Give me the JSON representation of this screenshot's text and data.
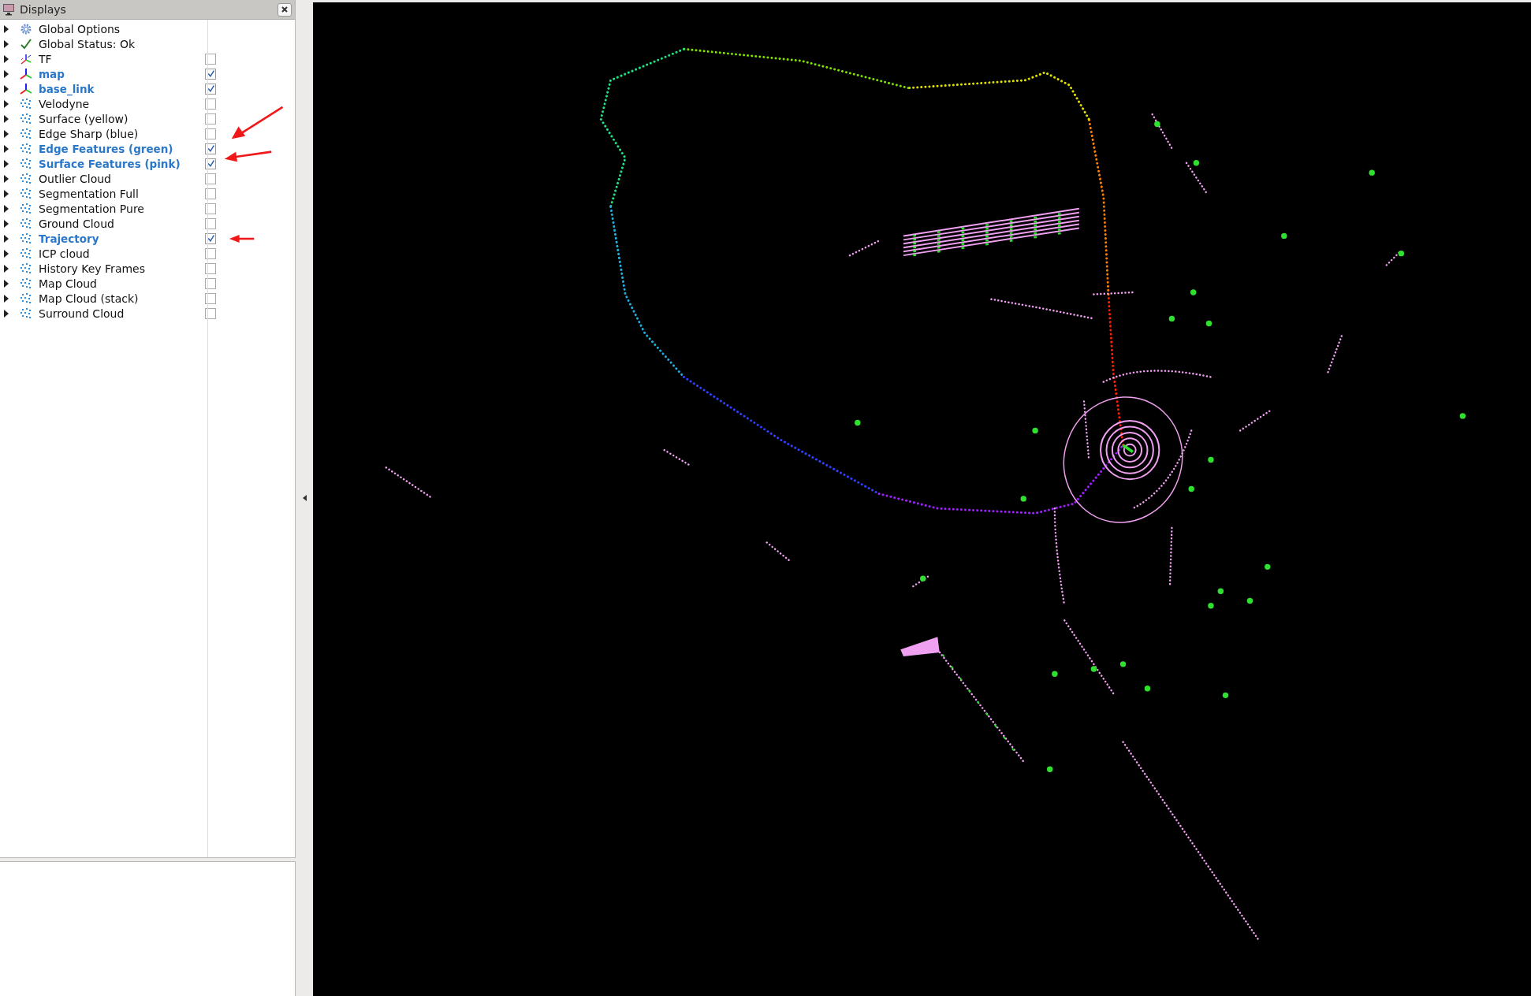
{
  "panel": {
    "title": "Displays"
  },
  "items": [
    {
      "label": "Global Options",
      "kind": "options"
    },
    {
      "label": "Global Status: Ok",
      "kind": "status"
    },
    {
      "label": "TF",
      "kind": "tf",
      "checked": false
    },
    {
      "label": "map",
      "kind": "axes",
      "checked": true
    },
    {
      "label": "base_link",
      "kind": "axes",
      "checked": true
    },
    {
      "label": "Velodyne",
      "kind": "cloud",
      "checked": false
    },
    {
      "label": "Surface (yellow)",
      "kind": "cloud",
      "checked": false
    },
    {
      "label": "Edge Sharp (blue)",
      "kind": "cloud",
      "checked": false
    },
    {
      "label": "Edge Features (green)",
      "kind": "cloud",
      "checked": true
    },
    {
      "label": "Surface Features (pink)",
      "kind": "cloud",
      "checked": true
    },
    {
      "label": "Outlier Cloud",
      "kind": "cloud",
      "checked": false
    },
    {
      "label": "Segmentation Full",
      "kind": "cloud",
      "checked": false
    },
    {
      "label": "Segmentation Pure",
      "kind": "cloud",
      "checked": false
    },
    {
      "label": "Ground Cloud",
      "kind": "cloud",
      "checked": false
    },
    {
      "label": "Trajectory",
      "kind": "cloud",
      "checked": true
    },
    {
      "label": "ICP cloud",
      "kind": "cloud",
      "checked": false
    },
    {
      "label": "History Key Frames",
      "kind": "cloud",
      "checked": false
    },
    {
      "label": "Map Cloud",
      "kind": "cloud",
      "checked": false
    },
    {
      "label": "Map Cloud (stack)",
      "kind": "cloud",
      "checked": false
    },
    {
      "label": "Surround Cloud",
      "kind": "cloud",
      "checked": false
    }
  ]
}
